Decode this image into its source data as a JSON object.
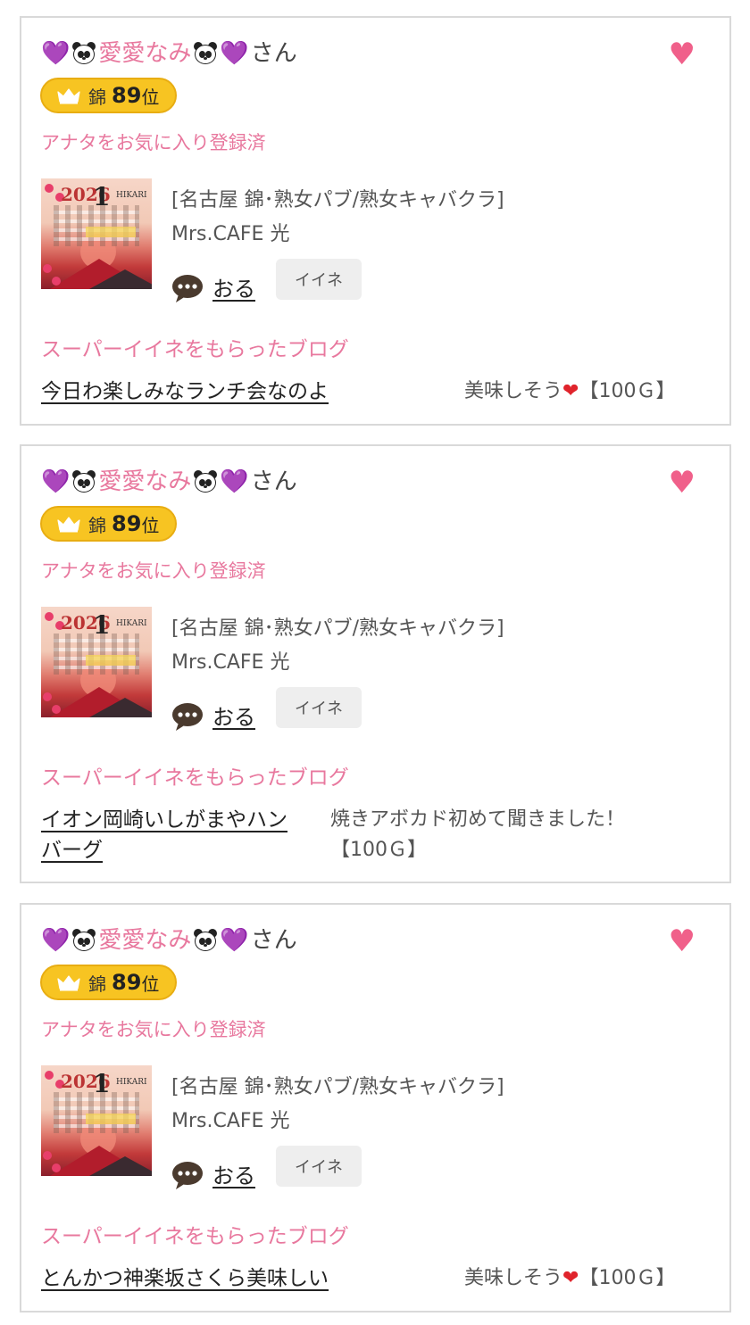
{
  "cards": [
    {
      "heart_emoji": "💜",
      "nickname": "愛愛なみ",
      "san": "さん",
      "rank_area": "錦",
      "rank_num": "89",
      "rank_suffix": "位",
      "fav_status": "アナタをお気に入り登録済",
      "shop_category": "[名古屋 錦･熟女パブ/熟女キャバクラ]",
      "shop_name": "Mrs.CAFE 光",
      "status": "おる",
      "iine_label": "イイネ",
      "section_title": "スーパーイイネをもらったブログ",
      "blog_title": "今日わ楽しみなランチ会なのよ",
      "comment_text": "美味しそう",
      "comment_suffix": "【100Ｇ】",
      "thumb_year": "2026",
      "thumb_month": "1",
      "thumb_brand": "HIKARI"
    },
    {
      "heart_emoji": "💜",
      "nickname": "愛愛なみ",
      "san": "さん",
      "rank_area": "錦",
      "rank_num": "89",
      "rank_suffix": "位",
      "fav_status": "アナタをお気に入り登録済",
      "shop_category": "[名古屋 錦･熟女パブ/熟女キャバクラ]",
      "shop_name": "Mrs.CAFE 光",
      "status": "おる",
      "iine_label": "イイネ",
      "section_title": "スーパーイイネをもらったブログ",
      "blog_title_line1": "イオン岡崎いしがまやハン",
      "blog_title_line2": "バーグ",
      "comment_line1": "焼きアボカド初めて聞きました！",
      "comment_line2": "【100Ｇ】",
      "thumb_year": "2026",
      "thumb_month": "1",
      "thumb_brand": "HIKARI"
    },
    {
      "heart_emoji": "💜",
      "nickname": "愛愛なみ",
      "san": "さん",
      "rank_area": "錦",
      "rank_num": "89",
      "rank_suffix": "位",
      "fav_status": "アナタをお気に入り登録済",
      "shop_category": "[名古屋 錦･熟女パブ/熟女キャバクラ]",
      "shop_name": "Mrs.CAFE 光",
      "status": "おる",
      "iine_label": "イイネ",
      "section_title": "スーパーイイネをもらったブログ",
      "blog_title": "とんかつ神楽坂さくら美味しい",
      "comment_text": "美味しそう",
      "comment_suffix": "【100Ｇ】",
      "thumb_year": "2026",
      "thumb_month": "1",
      "thumb_brand": "HIKARI"
    }
  ],
  "colors": {
    "pink_text": "#e8789e",
    "fav_heart": "#f0608a",
    "badge_gold": "#f7c422",
    "iine_bg": "#eeeeee"
  },
  "icons": {
    "favorite": "heart-icon",
    "crown": "crown-icon",
    "comment": "speech-bubble-icon",
    "panda": "panda-icon",
    "purple_heart": "purple-heart-icon",
    "red_heart": "red-heart-icon"
  }
}
